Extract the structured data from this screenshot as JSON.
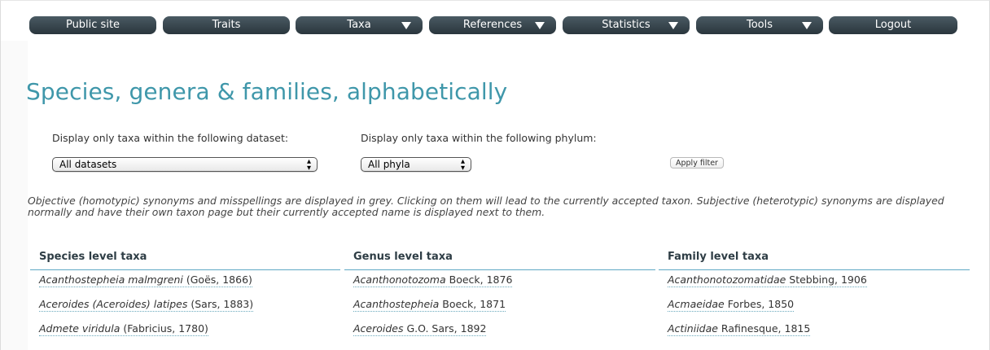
{
  "nav": [
    {
      "label": "Public site",
      "dropdown": false
    },
    {
      "label": "Traits",
      "dropdown": false
    },
    {
      "label": "Taxa",
      "dropdown": true
    },
    {
      "label": "References",
      "dropdown": true
    },
    {
      "label": "Statistics",
      "dropdown": true
    },
    {
      "label": "Tools",
      "dropdown": true
    },
    {
      "label": "Logout",
      "dropdown": false
    }
  ],
  "page": {
    "title": "Species, genera & families, alphabetically"
  },
  "filters": {
    "dataset_label": "Display only taxa within the following dataset:",
    "dataset_value": "All datasets",
    "phylum_label": "Display only taxa within the following phylum:",
    "phylum_value": "All phyla",
    "apply_label": "Apply filter"
  },
  "note": "Objective (homotypic) synonyms and misspellings are displayed in grey. Clicking on them will lead to the currently accepted taxon. Subjective (heterotypic) synonyms are displayed normally and have their own taxon page but their currently accepted name is displayed next to them.",
  "columns": [
    {
      "header": "Species level taxa",
      "items": [
        {
          "name": "Acanthostepheia malmgreni",
          "author": " (Goës, 1866)"
        },
        {
          "name": "Aceroides (Aceroides) latipes",
          "author": " (Sars, 1883)"
        },
        {
          "name": "Admete viridula",
          "author": " (Fabricius, 1780)"
        }
      ]
    },
    {
      "header": "Genus level taxa",
      "items": [
        {
          "name": "Acanthonotozoma",
          "author": " Boeck, 1876"
        },
        {
          "name": "Acanthostepheia",
          "author": " Boeck, 1871"
        },
        {
          "name": "Aceroides",
          "author": " G.O. Sars, 1892"
        }
      ]
    },
    {
      "header": "Family level taxa",
      "items": [
        {
          "name": "Acanthonotozomatidae",
          "author": " Stebbing, 1906"
        },
        {
          "name": "Acmaeidae",
          "author": " Forbes, 1850"
        },
        {
          "name": "Actiniidae",
          "author": " Rafinesque, 1815"
        }
      ]
    }
  ],
  "colors": {
    "nav_bg": "#2f3e46",
    "title": "#3f97aa",
    "column_rule": "#5fa8c4"
  }
}
